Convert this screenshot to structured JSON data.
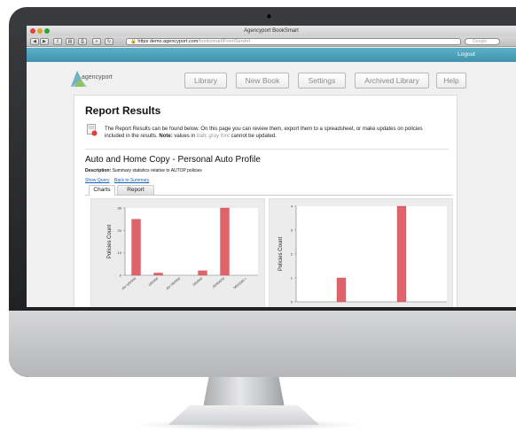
{
  "browser": {
    "window_title": "Agencyport BookSmart",
    "url_secure": "https",
    "url_host": "demo.agencyport.com",
    "url_path": "/booksmart/FrontServlet",
    "search_placeholder": "Google"
  },
  "app": {
    "logo_text": "agencyport",
    "logout": "Logout",
    "nav": [
      {
        "label": "Library"
      },
      {
        "label": "New Book"
      },
      {
        "label": "Settings"
      },
      {
        "label": "Archived Library"
      },
      {
        "label": "Help"
      }
    ]
  },
  "page": {
    "heading": "Report Results",
    "notice_text": "The Report Results can be found below. On this page you can review them, export them to a spreadsheet, or make updates on policies included in the results.",
    "notice_note_label": "Note:",
    "notice_note_pre": "values in",
    "notice_note_italic": "italic gray font",
    "notice_note_post": "cannot be updated.",
    "report_title": "Auto and Home Copy - Personal Auto Profile",
    "description_label": "Description:",
    "description_text": "Summary statistics relative to AUTOP policies",
    "links": [
      "Show Query",
      "Back to Summary"
    ],
    "tabs": [
      "Charts",
      "Report"
    ]
  },
  "colors": {
    "accent_bar": "#4aa3bd",
    "bar_fill": "#e0636a"
  },
  "chart_data": [
    {
      "type": "bar",
      "ylabel": "Policies Count",
      "ylim": [
        0,
        30
      ],
      "yticks": [
        "0",
        "10",
        "20",
        "30"
      ],
      "categories": [
        "..der 100/300",
        "100/300",
        "..der 250/500",
        "250/500",
        "..00/500/50",
        "500/1000 +"
      ],
      "values": [
        25,
        1,
        0,
        2,
        30,
        0
      ]
    },
    {
      "type": "bar",
      "ylabel": "Policies Count",
      "ylim": [
        0,
        4
      ],
      "yticks": [
        "0",
        "1",
        "2",
        "3",
        "4"
      ],
      "categories": [
        "",
        "",
        "",
        "",
        ""
      ],
      "values": [
        0,
        1,
        0,
        4,
        0
      ]
    }
  ]
}
